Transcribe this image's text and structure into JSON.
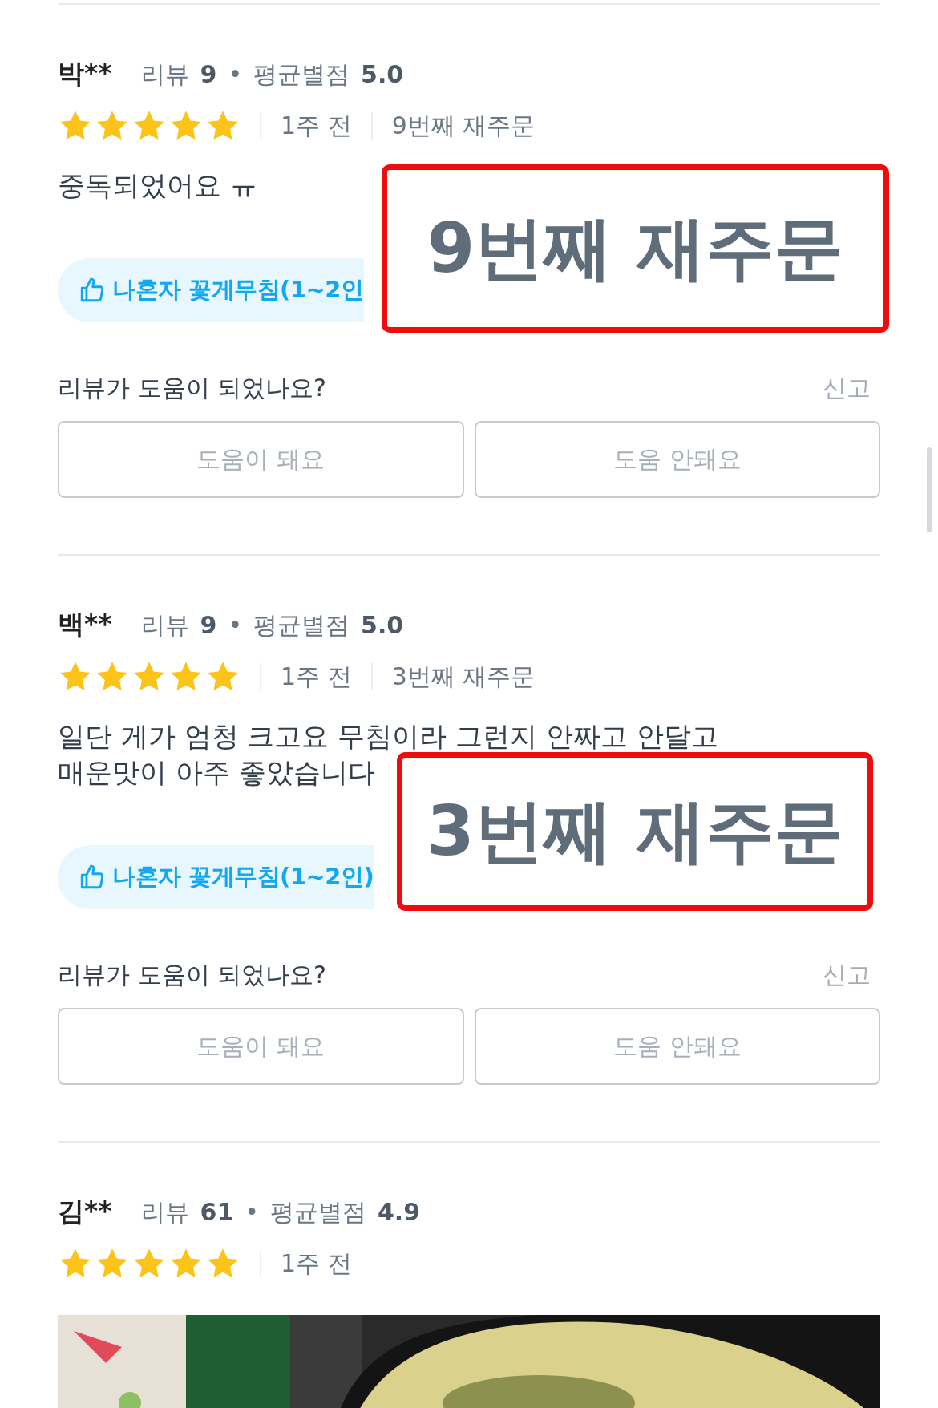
{
  "reviews": [
    {
      "name": "박**",
      "review_label": "리뷰",
      "review_count": "9",
      "separator": "•",
      "rating_label": "평균별점",
      "rating": "5.0",
      "stars": 5,
      "time": "1주 전",
      "reorder": "9번째 재주문",
      "body": "중독되었어요 ㅠ",
      "menu_chip": "나혼자 꽃게무침(1~2인",
      "callout": "9번째 재주문",
      "helpful_question": "리뷰가 도움이 되었나요?",
      "report": "신고",
      "buttons": [
        "도움이 돼요",
        "도움 안돼요"
      ]
    },
    {
      "name": "백**",
      "review_label": "리뷰",
      "review_count": "9",
      "separator": "•",
      "rating_label": "평균별점",
      "rating": "5.0",
      "stars": 5,
      "time": "1주 전",
      "reorder": "3번째 재주문",
      "body": "일단 게가 엄청 크고요 무침이라 그런지 안짜고 안달고\n매운맛이 아주 좋았습니다",
      "menu_chip": "나혼자 꽃게무침(1~2인)",
      "callout": "3번째 재주문",
      "helpful_question": "리뷰가 도움이 되었나요?",
      "report": "신고",
      "buttons": [
        "도움이 돼요",
        "도움 안돼요"
      ]
    },
    {
      "name": "김**",
      "review_label": "리뷰",
      "review_count": "61",
      "separator": "•",
      "rating_label": "평균별점",
      "rating": "4.9",
      "stars": 5,
      "time": "1주 전"
    }
  ]
}
